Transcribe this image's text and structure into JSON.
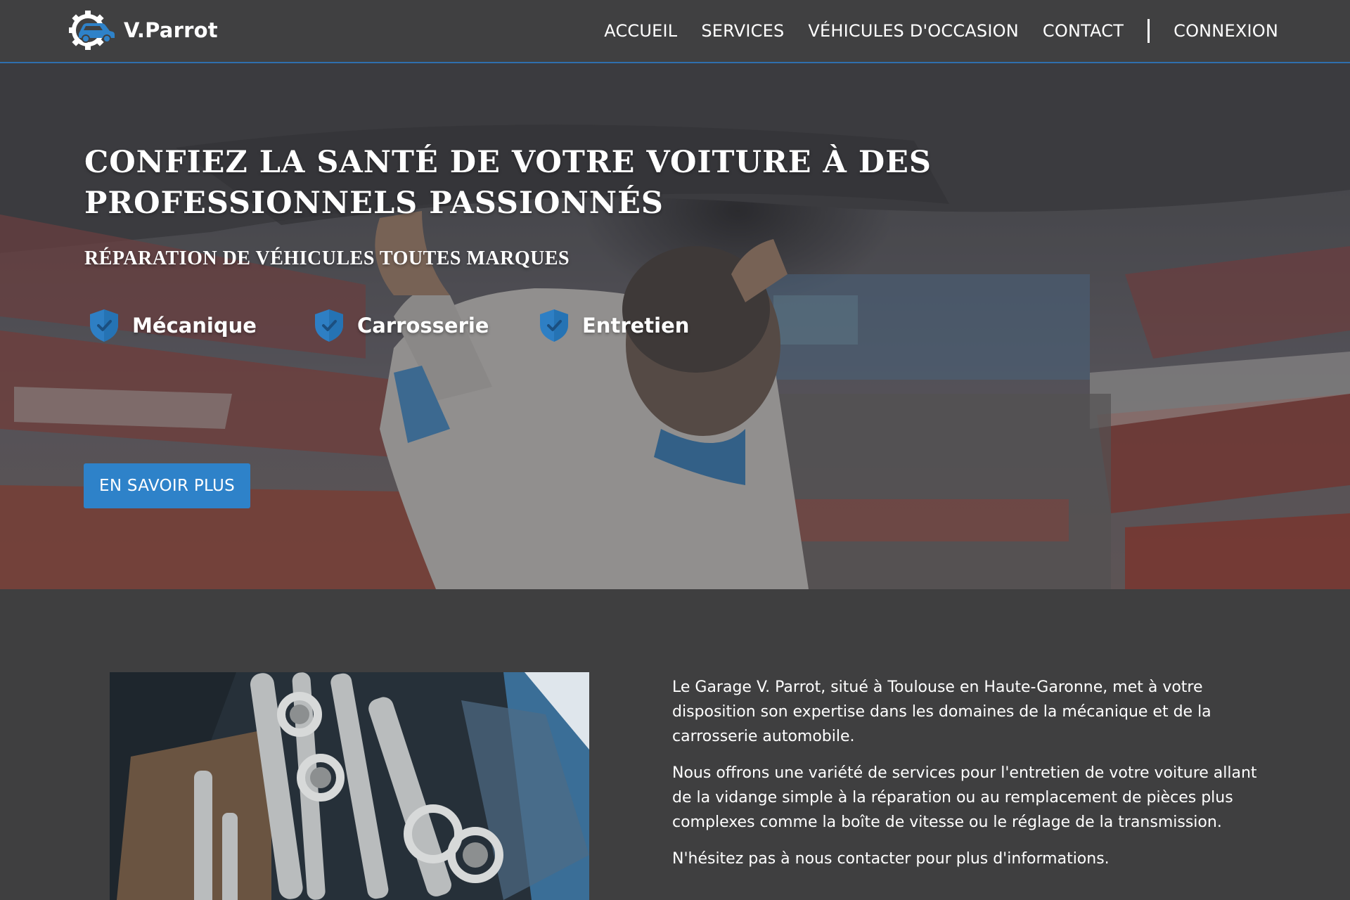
{
  "brand": {
    "name": "V.Parrot",
    "logo_icon": "gear-car-logo-icon",
    "accent_color": "#2e82c9"
  },
  "nav": {
    "items": [
      {
        "label": "ACCUEIL"
      },
      {
        "label": "SERVICES"
      },
      {
        "label": "VÉHICULES D'OCCASION"
      },
      {
        "label": "CONTACT"
      }
    ],
    "login_label": "CONNEXION"
  },
  "hero": {
    "title": "CONFIEZ LA SANTÉ DE VOTRE VOITURE À DES PROFESSIONNELS PASSIONNÉS",
    "subtitle": "RÉPARATION DE VÉHICULES TOUTES MARQUES",
    "features": [
      {
        "label": "Mécanique",
        "icon": "shield-check-icon"
      },
      {
        "label": "Carrosserie",
        "icon": "shield-check-icon"
      },
      {
        "label": "Entretien",
        "icon": "shield-check-icon"
      }
    ],
    "cta_label": "EN SAVOIR PLUS"
  },
  "about": {
    "paragraphs": [
      "Le Garage V. Parrot, situé à Toulouse en Haute-Garonne, met à votre disposition son expertise dans les domaines de la mécanique et de la carrosserie automobile.",
      "Nous offrons une variété de services pour l'entretien de votre voiture allant de la vidange simple à la réparation ou au remplacement de pièces plus complexes comme la boîte de vitesse ou le réglage de la transmission.",
      "N'hésitez pas à nous contacter pour plus d'informations."
    ]
  },
  "colors": {
    "background": "#3f3f40",
    "navbar": "#404041",
    "navbar_border": "#2f6fae",
    "button": "#2e82c9",
    "shield": "#2e7fc4"
  }
}
